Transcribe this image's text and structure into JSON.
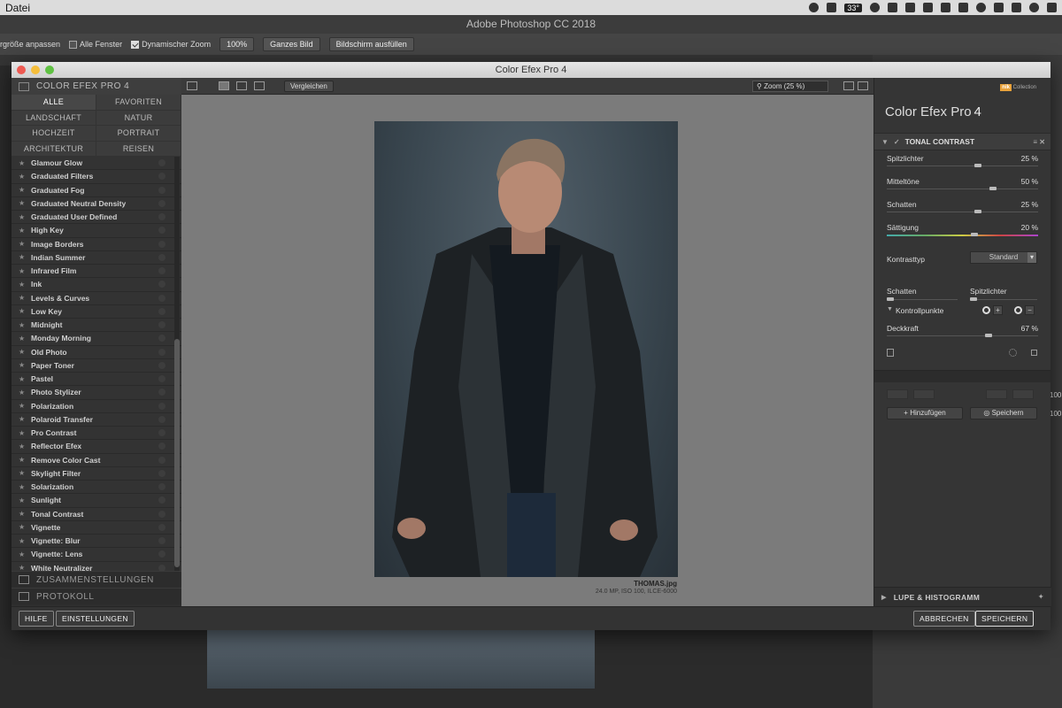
{
  "menubar": {
    "app_menu": "Datei",
    "temp": "33°"
  },
  "photoshop": {
    "title": "Adobe Photoshop CC 2018",
    "options": {
      "resize_windows": "rgröße anpassen",
      "all_windows": "Alle Fenster",
      "scrubby_zoom": "Dynamischer Zoom",
      "zoom_100": "100%",
      "fit_screen": "Ganzes Bild",
      "fill_screen": "Bildschirm ausfüllen"
    },
    "edge_values": [
      "100",
      "100"
    ]
  },
  "window": {
    "title": "Color Efex Pro 4"
  },
  "left_panel": {
    "header": "COLOR EFEX PRO 4",
    "categories": [
      {
        "label": "ALLE",
        "active": true
      },
      {
        "label": "FAVORITEN"
      },
      {
        "label": "LANDSCHAFT"
      },
      {
        "label": "NATUR"
      },
      {
        "label": "HOCHZEIT"
      },
      {
        "label": "PORTRAIT"
      },
      {
        "label": "ARCHITEKTUR"
      },
      {
        "label": "REISEN"
      }
    ],
    "filters": [
      "Glamour Glow",
      "Graduated Filters",
      "Graduated Fog",
      "Graduated Neutral Density",
      "Graduated User Defined",
      "High Key",
      "Image Borders",
      "Indian Summer",
      "Infrared Film",
      "Ink",
      "Levels & Curves",
      "Low Key",
      "Midnight",
      "Monday Morning",
      "Old Photo",
      "Paper Toner",
      "Pastel",
      "Photo Stylizer",
      "Polarization",
      "Polaroid Transfer",
      "Pro Contrast",
      "Reflector Efex",
      "Remove Color Cast",
      "Skylight Filter",
      "Solarization",
      "Sunlight",
      "Tonal Contrast",
      "Vignette",
      "Vignette: Blur",
      "Vignette: Lens",
      "White Neutralizer"
    ],
    "section_recipes": "ZUSAMMENSTELLUNGEN",
    "section_history": "PROTOKOLL"
  },
  "toolbar": {
    "compare": "Vergleichen",
    "zoom": "Zoom (25 %)"
  },
  "preview": {
    "filename": "THOMAS.jpg",
    "info": "24.0 MP, ISO 100, ILCE-6000"
  },
  "right_panel": {
    "nik_badge": "nik",
    "nik_label": "Collection",
    "brand": "Color Efex Pro",
    "brand_version": "4",
    "filter_name": "TONAL CONTRAST",
    "params": [
      {
        "label": "Spitzlichter",
        "value": "25 %",
        "level": 0.25
      },
      {
        "label": "Mitteltöne",
        "value": "50 %",
        "level": 0.5
      },
      {
        "label": "Schatten",
        "value": "25 %",
        "level": 0.25
      },
      {
        "label": "Sättigung",
        "value": "20 %",
        "level": 0.2
      }
    ],
    "contrast_type_label": "Kontrasttyp",
    "contrast_type_value": "Standard",
    "shadows_label": "Schatten",
    "highlights_label": "Spitzlichter",
    "control_points": "Kontrollpunkte",
    "opacity_label": "Deckkraft",
    "opacity_value": "67 %",
    "opacity_level": 0.67,
    "add_button": "Hinzufügen",
    "save_button": "Speichern",
    "loupe": "LUPE & HISTOGRAMM"
  },
  "bottom_bar": {
    "help": "HILFE",
    "settings": "EINSTELLUNGEN",
    "cancel": "ABBRECHEN",
    "save": "SPEICHERN"
  }
}
